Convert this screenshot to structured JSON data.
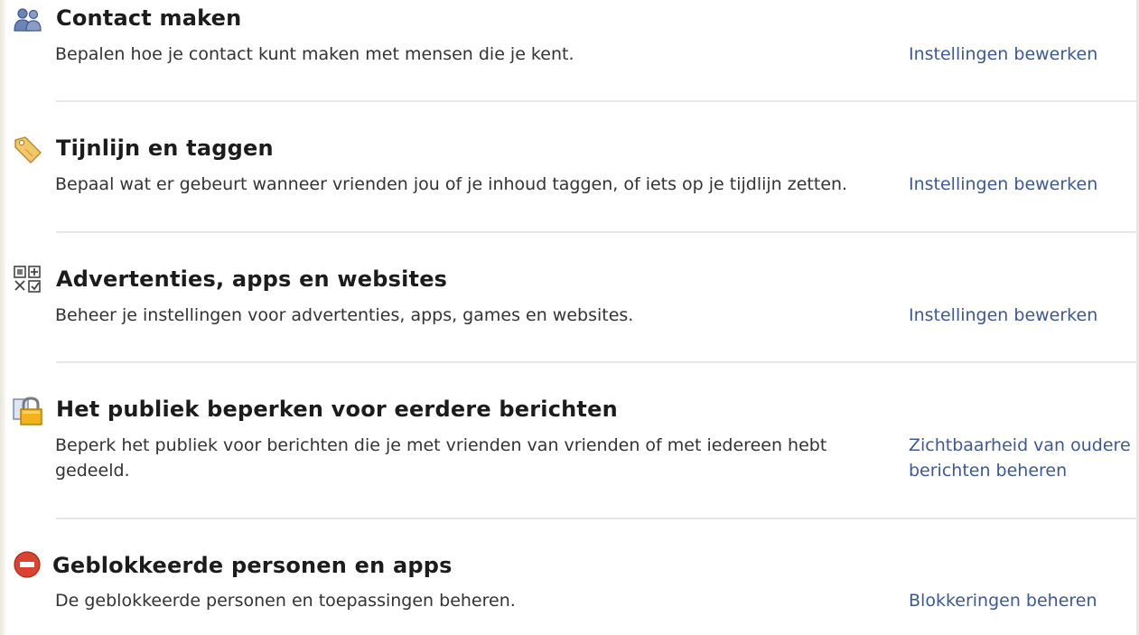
{
  "sections": [
    {
      "title": "Contact maken",
      "description": "Bepalen hoe je contact kunt maken met mensen die je kent.",
      "action": "Instellingen bewerken",
      "icon": "people-icon"
    },
    {
      "title": "Tijnlijn en taggen",
      "description": "Bepaal wat er gebeurt wanneer vrienden jou of je inhoud taggen, of iets op je tijdlijn zetten.",
      "action": "Instellingen bewerken",
      "icon": "tag-icon"
    },
    {
      "title": "Advertenties, apps en websites",
      "description": "Beheer je instellingen voor advertenties, apps, games en websites.",
      "action": "Instellingen bewerken",
      "icon": "apps-grid-icon"
    },
    {
      "title": "Het publiek beperken voor eerdere berichten",
      "description": "Beperk het publiek voor berichten die je met vrienden van vrienden of met iedereen hebt gedeeld.",
      "action": "Zichtbaarheid van oudere berichten beheren",
      "icon": "lock-icon"
    },
    {
      "title": "Geblokkeerde personen en apps",
      "description": "De geblokkeerde personen en toepassingen beheren.",
      "action": "Blokkeringen beheren",
      "icon": "blocked-icon"
    }
  ],
  "colors": {
    "link": "#3b5998",
    "title": "#1c1c1c",
    "text": "#333333",
    "divider": "#e7e7e7",
    "blocked": "#d9432f"
  }
}
